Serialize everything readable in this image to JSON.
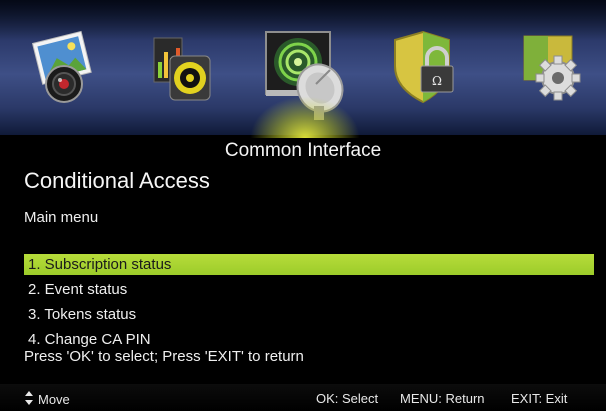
{
  "top_menu": {
    "icons": [
      {
        "name": "pictures-icon"
      },
      {
        "name": "music-icon"
      },
      {
        "name": "common-interface-icon",
        "selected": true
      },
      {
        "name": "parental-lock-icon"
      },
      {
        "name": "settings-icon"
      }
    ]
  },
  "section_title": "Common Interface",
  "screen_title": "Conditional Access",
  "menu_caption": "Main menu",
  "menu": {
    "selected_index": 0,
    "items": [
      {
        "label": "1. Subscription status"
      },
      {
        "label": "2. Event status"
      },
      {
        "label": "3. Tokens status"
      },
      {
        "label": "4. Change CA PIN"
      }
    ]
  },
  "hint": "Press 'OK' to select; Press 'EXIT' to return",
  "help_bar": {
    "move_icon": "up-down-arrow-icon",
    "move": "Move",
    "ok": "OK: Select",
    "menu": "MENU: Return",
    "exit": "EXIT: Exit"
  },
  "colors": {
    "highlight": "#a8d332",
    "background": "#000000",
    "topbar": "#3e4f86"
  }
}
